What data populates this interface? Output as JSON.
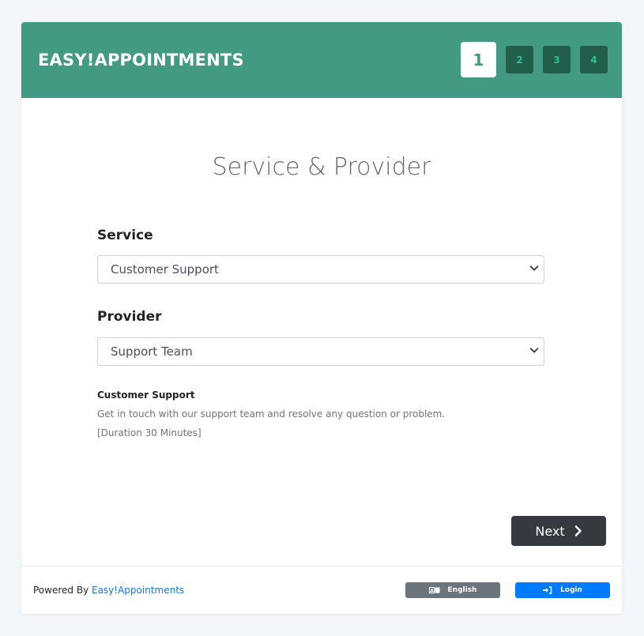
{
  "header": {
    "brand": "EASY!APPOINTMENTS",
    "steps": [
      {
        "label": "1",
        "active": true
      },
      {
        "label": "2",
        "active": false
      },
      {
        "label": "3",
        "active": false
      },
      {
        "label": "4",
        "active": false
      }
    ]
  },
  "main": {
    "title": "Service & Provider",
    "service": {
      "label": "Service",
      "selected": "Customer Support"
    },
    "provider": {
      "label": "Provider",
      "selected": "Support Team"
    },
    "description": {
      "title": "Customer Support",
      "text": "Get in touch with our support team and resolve any question or problem.",
      "duration": "[Duration 30 Minutes]"
    },
    "next_label": "Next"
  },
  "footer": {
    "powered_by": "Powered By ",
    "powered_link": "Easy!Appointments",
    "language_label": "English",
    "login_label": "Login"
  },
  "colors": {
    "header_bg": "#429a82",
    "step_inactive_bg": "#225e4c",
    "step_inactive_text": "#29c095",
    "next_bg": "#343a40",
    "language_bg": "#6c757d",
    "login_bg": "#007bff",
    "link": "#1a73e8"
  }
}
